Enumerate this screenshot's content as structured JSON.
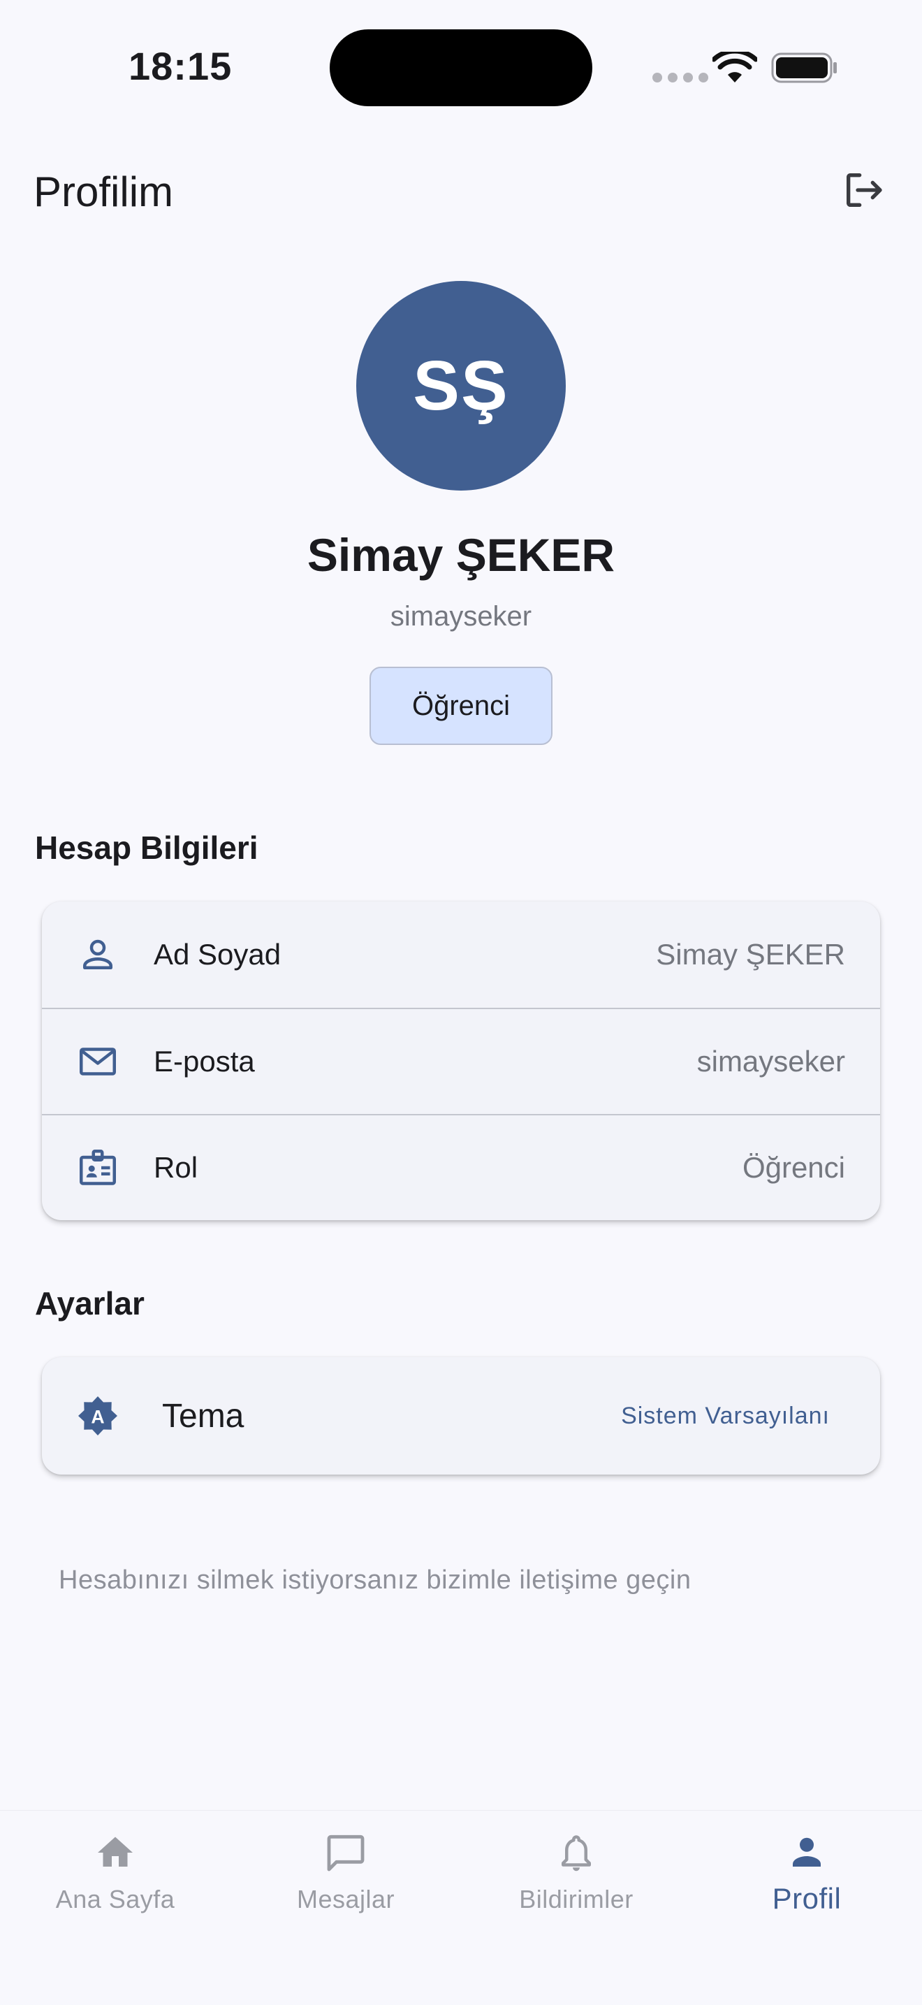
{
  "status_bar": {
    "time": "18:15"
  },
  "app_bar": {
    "title": "Profilim",
    "logout_icon": "logout-icon"
  },
  "profile": {
    "initials": "SŞ",
    "name": "Simay ŞEKER",
    "username": "simayseker",
    "role_chip": "Öğrenci"
  },
  "account_section": {
    "title": "Hesap Bilgileri",
    "rows": [
      {
        "icon": "person-icon",
        "label": "Ad Soyad",
        "value": "Simay ŞEKER"
      },
      {
        "icon": "email-icon",
        "label": "E-posta",
        "value": "simayseker"
      },
      {
        "icon": "badge-icon",
        "label": "Rol",
        "value": "Öğrenci"
      }
    ]
  },
  "settings_section": {
    "title": "Ayarlar",
    "theme": {
      "icon": "theme-icon",
      "label": "Tema",
      "value": "Sistem Varsayılanı"
    }
  },
  "delete_note": "Hesabınızı silmek istiyorsanız bizimle iletişime geçin",
  "bottom_nav": {
    "items": [
      {
        "icon": "home-icon",
        "label": "Ana Sayfa",
        "active": false
      },
      {
        "icon": "chat-icon",
        "label": "Mesajlar",
        "active": false
      },
      {
        "icon": "bell-icon",
        "label": "Bildirimler",
        "active": false
      },
      {
        "icon": "person-icon",
        "label": "Profil",
        "active": true
      }
    ]
  },
  "colors": {
    "primary": "#415f91",
    "background": "#f8f8fd",
    "card": "#f2f3f9",
    "chip": "#d6e3ff",
    "muted_text": "#74777f"
  }
}
